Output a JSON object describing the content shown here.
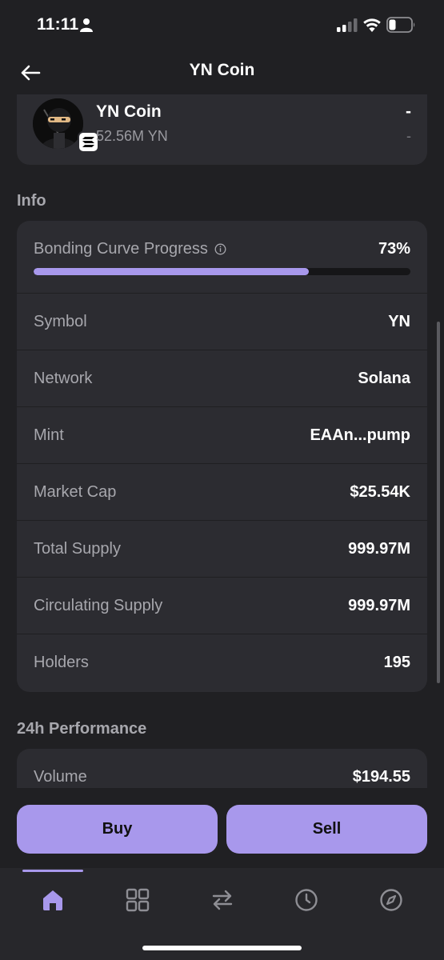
{
  "status_bar": {
    "time": "11:11"
  },
  "header": {
    "title": "YN Coin"
  },
  "token": {
    "name": "YN Coin",
    "balance": "52.56M YN",
    "value": "-",
    "change": "-"
  },
  "info": {
    "section_title": "Info",
    "progress_label": "Bonding Curve Progress",
    "progress_value": "73%",
    "progress_fraction": 0.73,
    "rows": [
      {
        "label": "Symbol",
        "value": "YN"
      },
      {
        "label": "Network",
        "value": "Solana"
      },
      {
        "label": "Mint",
        "value": "EAAn...pump"
      },
      {
        "label": "Market Cap",
        "value": "$25.54K"
      },
      {
        "label": "Total Supply",
        "value": "999.97M"
      },
      {
        "label": "Circulating Supply",
        "value": "999.97M"
      },
      {
        "label": "Holders",
        "value": "195"
      }
    ]
  },
  "performance": {
    "section_title": "24h Performance",
    "rows": [
      {
        "label": "Volume",
        "value": "$194.55"
      }
    ]
  },
  "actions": {
    "buy_label": "Buy",
    "sell_label": "Sell"
  },
  "tabs": [
    {
      "name": "home",
      "icon": "home-icon",
      "active": true
    },
    {
      "name": "apps",
      "icon": "grid-icon",
      "active": false
    },
    {
      "name": "swap",
      "icon": "swap-icon",
      "active": false
    },
    {
      "name": "history",
      "icon": "clock-icon",
      "active": false
    },
    {
      "name": "explore",
      "icon": "compass-icon",
      "active": false
    }
  ],
  "colors": {
    "accent": "#a898ec",
    "background": "#202023",
    "card": "#2c2c31",
    "muted_text": "#a7a7ad"
  }
}
